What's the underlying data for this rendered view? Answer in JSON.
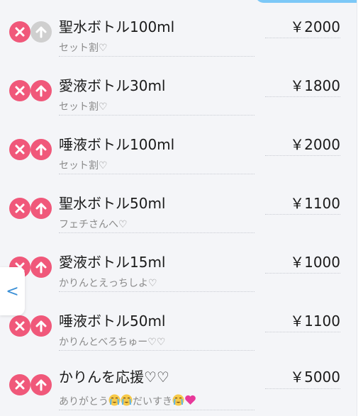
{
  "colors": {
    "delete_button": "#f0587a",
    "up_button_active": "#f0587a",
    "up_button_disabled": "#cfcfcf",
    "nav_accent": "#3a8fd6"
  },
  "nav": {
    "back_glyph": "<"
  },
  "items": [
    {
      "name": "聖水ボトル100ml",
      "price": "￥2000",
      "comment": "セット割♡",
      "up_disabled": true
    },
    {
      "name": "愛液ボトル30ml",
      "price": "￥1800",
      "comment": "セット割♡",
      "up_disabled": false
    },
    {
      "name": "唾液ボトル100ml",
      "price": "￥2000",
      "comment": "セット割♡",
      "up_disabled": false
    },
    {
      "name": "聖水ボトル50ml",
      "price": "￥1100",
      "comment": "フェチさんへ♡",
      "up_disabled": false
    },
    {
      "name": "愛液ボトル15ml",
      "price": "￥1000",
      "comment": "かりんとえっちしよ♡",
      "up_disabled": false
    },
    {
      "name": "唾液ボトル50ml",
      "price": "￥1100",
      "comment": "かりんとべろちゅー♡♡",
      "up_disabled": false
    },
    {
      "name": "かりんを応援♡♡",
      "price": "￥5000",
      "comment_parts": [
        "ありがとう",
        "だいすき"
      ],
      "up_disabled": false
    }
  ]
}
